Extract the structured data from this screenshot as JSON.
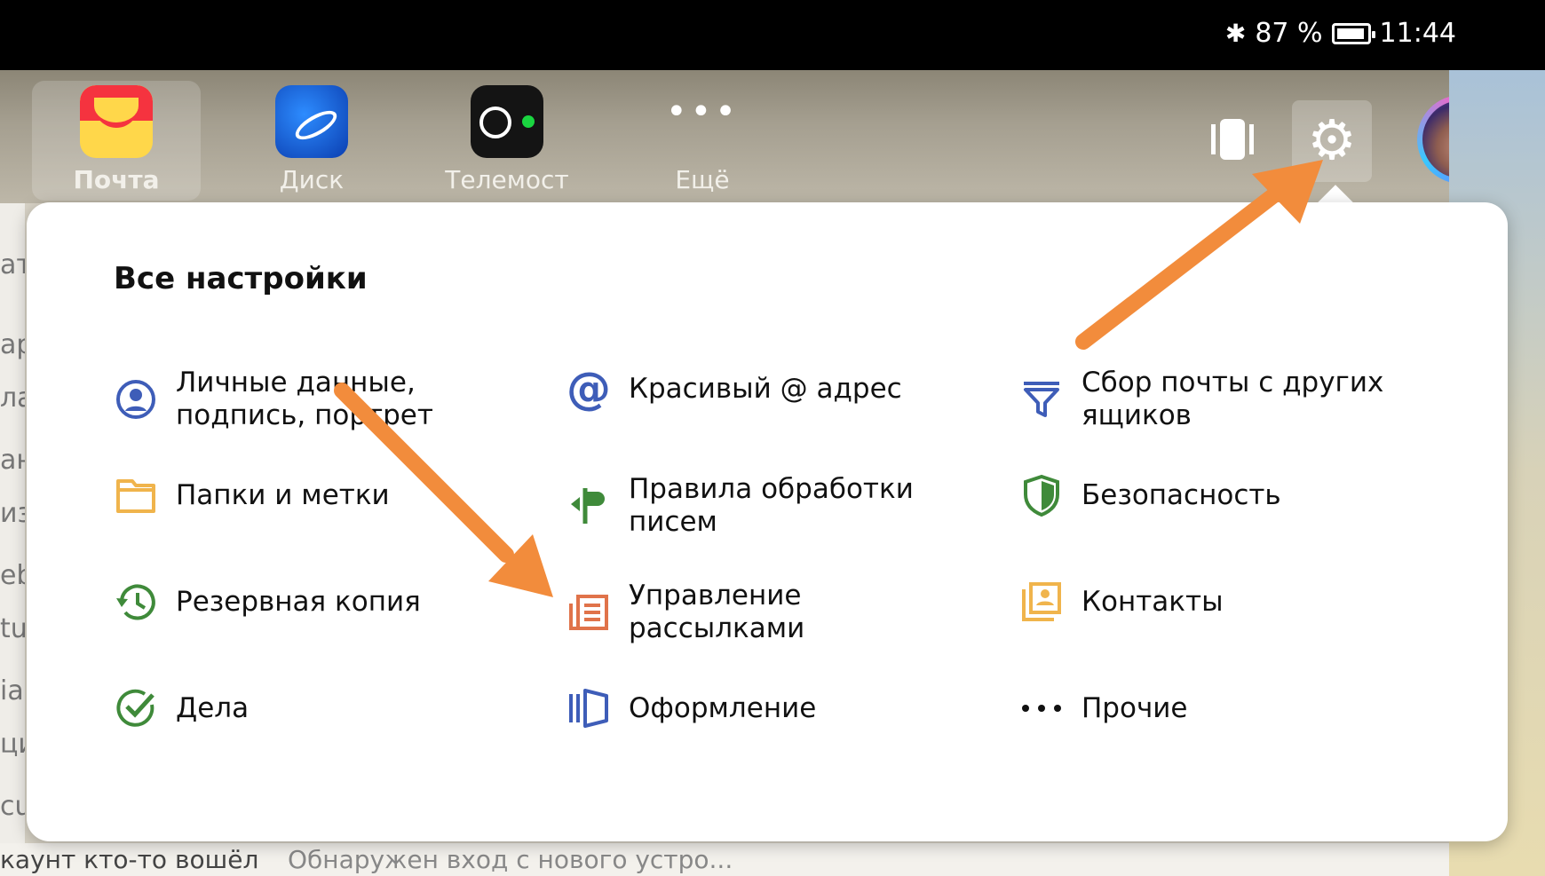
{
  "status": {
    "battery": "87 %",
    "time": "11:44"
  },
  "services": [
    {
      "label": "Почта",
      "icon": "mail-icon"
    },
    {
      "label": "Диск",
      "icon": "disk-icon"
    },
    {
      "label": "Телемост",
      "icon": "telemost-icon"
    },
    {
      "label": "Ещё",
      "icon": "more-icon"
    }
  ],
  "settings": {
    "title": "Все настройки",
    "items": [
      {
        "label": "Личные данные, подпись, портрет",
        "icon": "person-icon",
        "color": "#3e5db8"
      },
      {
        "label": "Красивый @ адрес",
        "icon": "at-icon",
        "color": "#3e5db8"
      },
      {
        "label": "Сбор почты с других ящиков",
        "icon": "funnel-icon",
        "color": "#3e5db8"
      },
      {
        "label": "Папки и метки",
        "icon": "folder-icon",
        "color": "#f0b44c"
      },
      {
        "label": "Правила обработки писем",
        "icon": "rules-icon",
        "color": "#3f8a3a"
      },
      {
        "label": "Безопасность",
        "icon": "shield-icon",
        "color": "#3f8a3a"
      },
      {
        "label": "Резервная копия",
        "icon": "backup-icon",
        "color": "#3f8a3a"
      },
      {
        "label": "Управление рассылками",
        "icon": "newsletter-icon",
        "color": "#e0734a"
      },
      {
        "label": "Контакты",
        "icon": "contacts-icon",
        "color": "#f0b44c"
      },
      {
        "label": "Дела",
        "icon": "check-icon",
        "color": "#3f8a3a"
      },
      {
        "label": "Оформление",
        "icon": "theme-icon",
        "color": "#3e5db8"
      },
      {
        "label": "Прочие",
        "icon": "dots-icon",
        "color": "#111111"
      }
    ]
  },
  "background": {
    "left_fragments": [
      "ат",
      "ар",
      "ла",
      "ан",
      "из",
      "eb",
      "tui",
      "ia",
      "ци",
      "cu"
    ],
    "bottom_left": "каунт кто-то вошёл",
    "bottom_right": "Обнаружен вход с нового устро..."
  },
  "annotation_color": "#f28c3c"
}
